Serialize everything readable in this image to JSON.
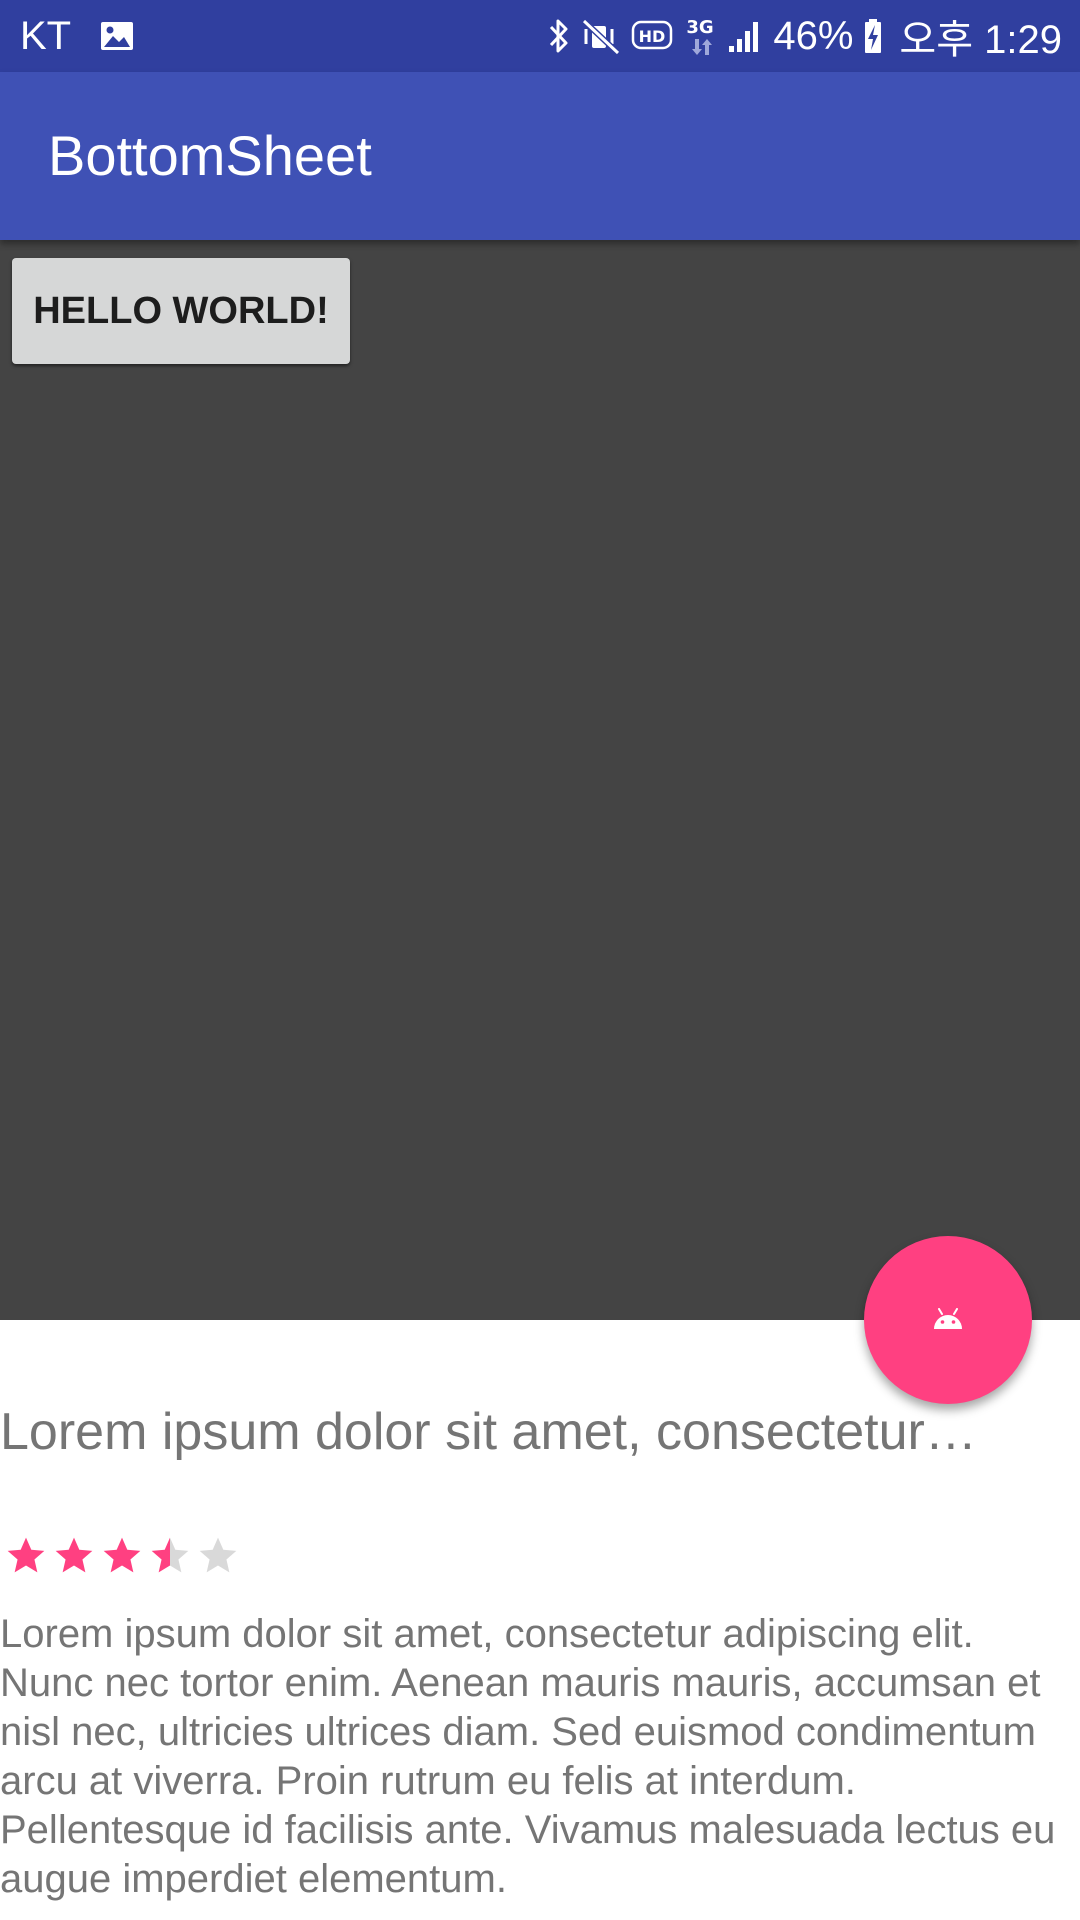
{
  "status_bar": {
    "carrier": "KT",
    "battery_percent": "46%",
    "time": "오후 1:29",
    "icons": [
      "image-icon",
      "bluetooth-icon",
      "mute-vibrate-icon",
      "hd-icon",
      "3g-icon",
      "signal-icon",
      "battery-charging-icon"
    ]
  },
  "app_bar": {
    "title": "BottomSheet"
  },
  "content": {
    "button_label": "HELLO WORLD!"
  },
  "fab": {
    "icon": "android-icon",
    "color": "#ff4081"
  },
  "bottom_sheet": {
    "title": "Lorem ipsum dolor sit amet, consectetur…",
    "rating": {
      "value": 3.5,
      "max": 5
    },
    "body": "Lorem ipsum dolor sit amet, consectetur adipiscing elit. Nunc nec tortor enim. Aenean mauris mauris, accumsan et nisl nec, ultricies ultrices diam. Sed euismod condimentum arcu at viverra. Proin rutrum eu felis at interdum. Pellentesque id facilisis ante. Vivamus malesuada lectus eu augue imperdiet elementum."
  },
  "colors": {
    "status_bar": "#303f9f",
    "app_bar": "#3f51b5",
    "accent": "#ff4081",
    "scrim": "#444444",
    "star_empty": "#d9d9d9",
    "sheet_text": "#757575"
  }
}
